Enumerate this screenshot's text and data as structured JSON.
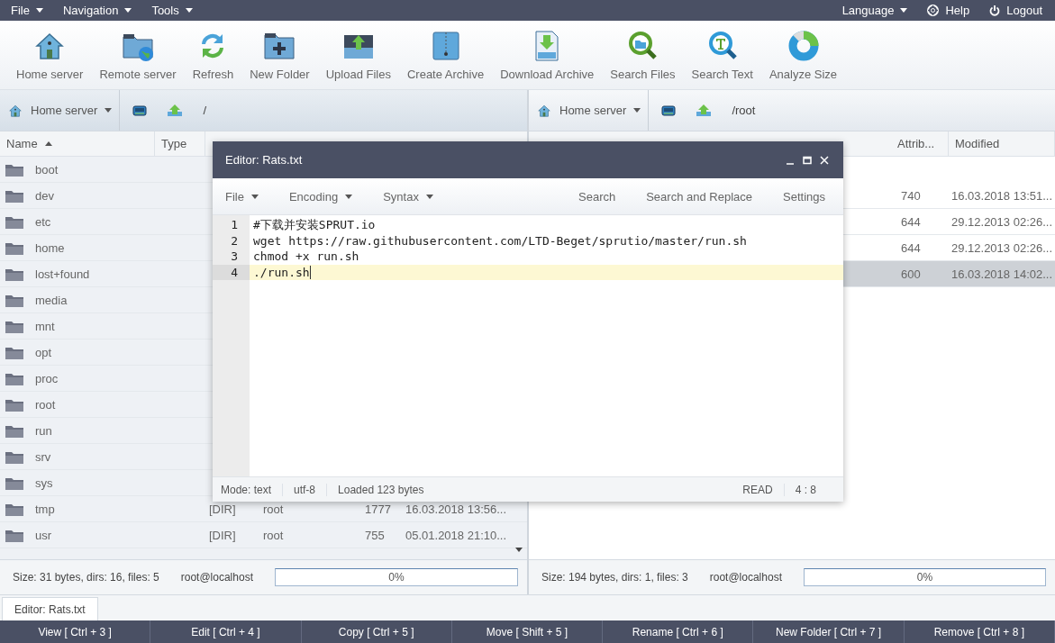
{
  "menu_bar": {
    "left": [
      {
        "label": "File"
      },
      {
        "label": "Navigation"
      },
      {
        "label": "Tools"
      }
    ],
    "right": [
      {
        "label": "Language",
        "kind": "dropdown"
      },
      {
        "label": "Help",
        "kind": "help"
      },
      {
        "label": "Logout",
        "kind": "power"
      }
    ]
  },
  "toolbar": [
    {
      "label": "Home server",
      "kind": "home"
    },
    {
      "label": "Remote server",
      "kind": "remote"
    },
    {
      "label": "Refresh",
      "kind": "refresh"
    },
    {
      "label": "New Folder",
      "kind": "newfolder"
    },
    {
      "label": "Upload Files",
      "kind": "upload"
    },
    {
      "label": "Create Archive",
      "kind": "archive"
    },
    {
      "label": "Download Archive",
      "kind": "zip"
    },
    {
      "label": "Search Files",
      "kind": "searchfiles"
    },
    {
      "label": "Search Text",
      "kind": "searchtext"
    },
    {
      "label": "Analyze Size",
      "kind": "analyze"
    }
  ],
  "panels": [
    {
      "server": "Home server",
      "path": "/",
      "columns": [
        {
          "label": "Name",
          "sorted": true
        },
        {
          "label": "Type",
          "sorted": false
        }
      ],
      "rows": [
        {
          "name": "boot",
          "selected": false
        },
        {
          "name": "dev",
          "selected": false
        },
        {
          "name": "etc",
          "selected": false
        },
        {
          "name": "home",
          "selected": false
        },
        {
          "name": "lost+found",
          "selected": false
        },
        {
          "name": "media",
          "selected": false
        },
        {
          "name": "mnt",
          "selected": false
        },
        {
          "name": "opt",
          "selected": false
        },
        {
          "name": "proc",
          "selected": false
        },
        {
          "name": "root",
          "selected": false
        },
        {
          "name": "run",
          "selected": false
        },
        {
          "name": "srv",
          "selected": false
        },
        {
          "name": "sys",
          "selected": false
        },
        {
          "name": "tmp",
          "type": "[DIR]",
          "owner": "root",
          "attrib": "1777",
          "modified": "16.03.2018 13:56...",
          "selected": false
        },
        {
          "name": "usr",
          "type": "[DIR]",
          "owner": "root",
          "attrib": "755",
          "modified": "05.01.2018 21:10...",
          "selected": false
        }
      ],
      "status": {
        "summary": "Size: 31 bytes, dirs: 16, files: 5",
        "host": "root@localhost",
        "level": 0,
        "reading": "0%"
      }
    },
    {
      "server": "Home server",
      "path": "/root",
      "columns": [
        {
          "label": "Attrib...",
          "sorted": false
        },
        {
          "label": "Modified",
          "sorted": false
        }
      ],
      "rows": [
        {
          "attrib": "740",
          "modified": "16.03.2018 13:51...",
          "selected": false
        },
        {
          "attrib": "644",
          "modified": "29.12.2013 02:26...",
          "selected": false
        },
        {
          "attrib": "644",
          "modified": "29.12.2013 02:26...",
          "selected": false
        },
        {
          "attrib": "600",
          "modified": "16.03.2018 14:02...",
          "selected": true
        }
      ],
      "status": {
        "summary": "Size: 194 bytes, dirs: 1, files: 3",
        "host": "root@localhost",
        "level": 0,
        "reading": "0%"
      }
    }
  ],
  "editor": {
    "title": "Editor: Rats.txt",
    "menus": [
      {
        "label": "File"
      },
      {
        "label": "Encoding"
      },
      {
        "label": "Syntax"
      }
    ],
    "actions": [
      {
        "label": "Search"
      },
      {
        "label": "Search and Replace"
      },
      {
        "label": "Settings"
      }
    ],
    "lines": [
      {
        "number": "1",
        "text": "#下载并安装SPRUT.io",
        "active": false
      },
      {
        "number": "2",
        "text": "wget https://raw.githubusercontent.com/LTD-Beget/sprutio/master/run.sh",
        "active": false
      },
      {
        "number": "3",
        "text": "chmod +x run.sh",
        "active": false
      },
      {
        "number": "4",
        "text": "./run.sh",
        "active": true
      }
    ],
    "status_left": [
      "Mode: text",
      "utf-8",
      "Loaded 123 bytes"
    ],
    "status_right": [
      "READ",
      "4 : 8"
    ]
  },
  "tabs": [
    {
      "label": "Editor: Rats.txt",
      "selected": true
    }
  ],
  "function_keys": [
    "View [ Ctrl + 3 ]",
    "Edit [ Ctrl + 4 ]",
    "Copy [ Ctrl + 5 ]",
    "Move [ Shift + 5 ]",
    "Rename [ Ctrl + 6 ]",
    "New Folder [ Ctrl + 7 ]",
    "Remove [ Ctrl + 8 ]"
  ]
}
